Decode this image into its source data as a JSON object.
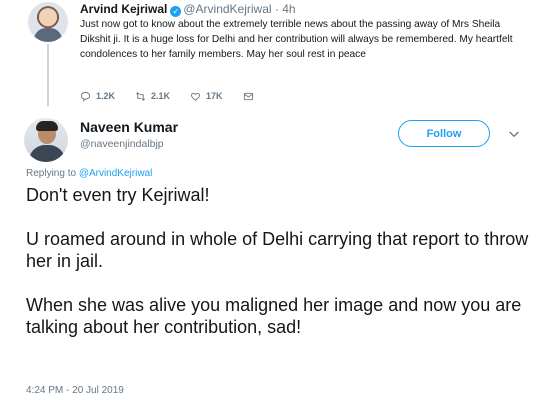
{
  "parent_tweet": {
    "name": "Arvind Kejriwal",
    "handle_time": "@ArvindKejriwal · 4h",
    "text": "Just now got to know about the extremely terrible news about the passing away of Mrs Sheila Dikshit ji. It is a huge loss for Delhi and her contribution will always be remembered. My heartfelt condolences to her family members. May her soul rest in peace",
    "actions": {
      "replies": "1.2K",
      "retweets": "2.1K",
      "likes": "17K"
    },
    "icons": [
      "reply-icon",
      "retweet-icon",
      "like-icon",
      "message-icon",
      "verified-icon"
    ]
  },
  "reply_tweet": {
    "name": "Naveen Kumar",
    "handle": "@naveenjindalbjp",
    "follow_label": "Follow",
    "replying_prefix": "Replying to",
    "replying_to": "@ArvindKejriwal",
    "paragraphs": [
      "Don't even try Kejriwal!",
      "U roamed around in whole of Delhi carrying that report to throw her in jail.",
      "When she was alive you maligned her image and now you are talking about her contribution, sad!"
    ],
    "timestamp": "4:24 PM - 20 Jul 2019"
  },
  "colors": {
    "accent": "#1da1f2",
    "text": "#14171a",
    "muted": "#657786"
  }
}
